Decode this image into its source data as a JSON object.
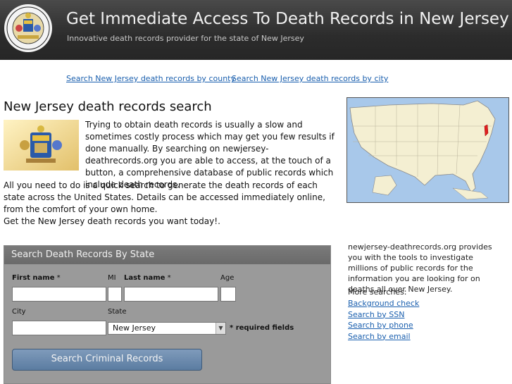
{
  "header": {
    "title": "Get Immediate Access To Death Records in New Jersey",
    "tagline": "Innovative death records provider for the state of New Jersey"
  },
  "nav": [
    {
      "label": "Search New Jersey death records by county"
    },
    {
      "label": "Search New Jersey death records by city"
    }
  ],
  "main": {
    "heading": "New Jersey death records search",
    "intro": "Trying to obtain death records is usually a slow and sometimes costly process which may get you few results if done manually. By searching on newjersey-deathrecords.org you are able to access, at the touch of a button, a comprehensive database of public records which include death records.",
    "body1": "All you need to do is a quick search to generate the death records of each state across the United States. Details can be accessed immediately online, from the comfort of your own home.",
    "body2": "Get the New Jersey death records you want today!."
  },
  "form": {
    "heading": "Search Death Records By State",
    "first_name_label": "First name",
    "mi_label": "MI",
    "last_name_label": "Last name",
    "age_label": "Age",
    "city_label": "City",
    "state_label": "State",
    "required_marker": "*",
    "state_value": "New Jersey",
    "required_note": "* required fields",
    "submit_label": "Search Criminal Records"
  },
  "sidebar": {
    "description": "newjersey-deathrecords.org provides you with the tools to investigate millions of public records for the information you are looking for on deaths all over New Jersey.",
    "more_label": "More searches:",
    "links": [
      {
        "label": "Background check"
      },
      {
        "label": "Search by SSN"
      },
      {
        "label": "Search by phone"
      },
      {
        "label": "Search by email"
      }
    ]
  },
  "colors": {
    "header_bg": "#2c2c2c",
    "link": "#1a5fae",
    "form_bg": "#9a9a9a",
    "button": "#6a89ad",
    "highlight_state": "#e02020"
  }
}
